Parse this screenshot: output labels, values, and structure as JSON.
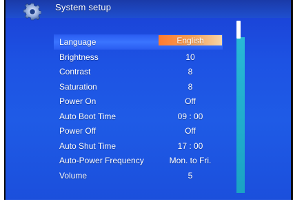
{
  "header": {
    "title": "System setup",
    "icon": "gear-icon"
  },
  "settings": [
    {
      "label": "Language",
      "value": "English",
      "selected": true
    },
    {
      "label": "Brightness",
      "value": "10"
    },
    {
      "label": "Contrast",
      "value": "8"
    },
    {
      "label": "Saturation",
      "value": "8"
    },
    {
      "label": "Power On",
      "value": "Off"
    },
    {
      "label": "Auto Boot Time",
      "value": "09 : 00"
    },
    {
      "label": "Power Off",
      "value": "Off"
    },
    {
      "label": "Auto Shut Time",
      "value": "17 : 00"
    },
    {
      "label": "Auto-Power Frequency",
      "value": "Mon. to Fri."
    },
    {
      "label": "Volume",
      "value": "5"
    }
  ],
  "colors": {
    "background": "#1d52e3",
    "highlight": "#ff7a2e",
    "scrollbar": "#1aa3c4",
    "text": "#ffffff"
  }
}
